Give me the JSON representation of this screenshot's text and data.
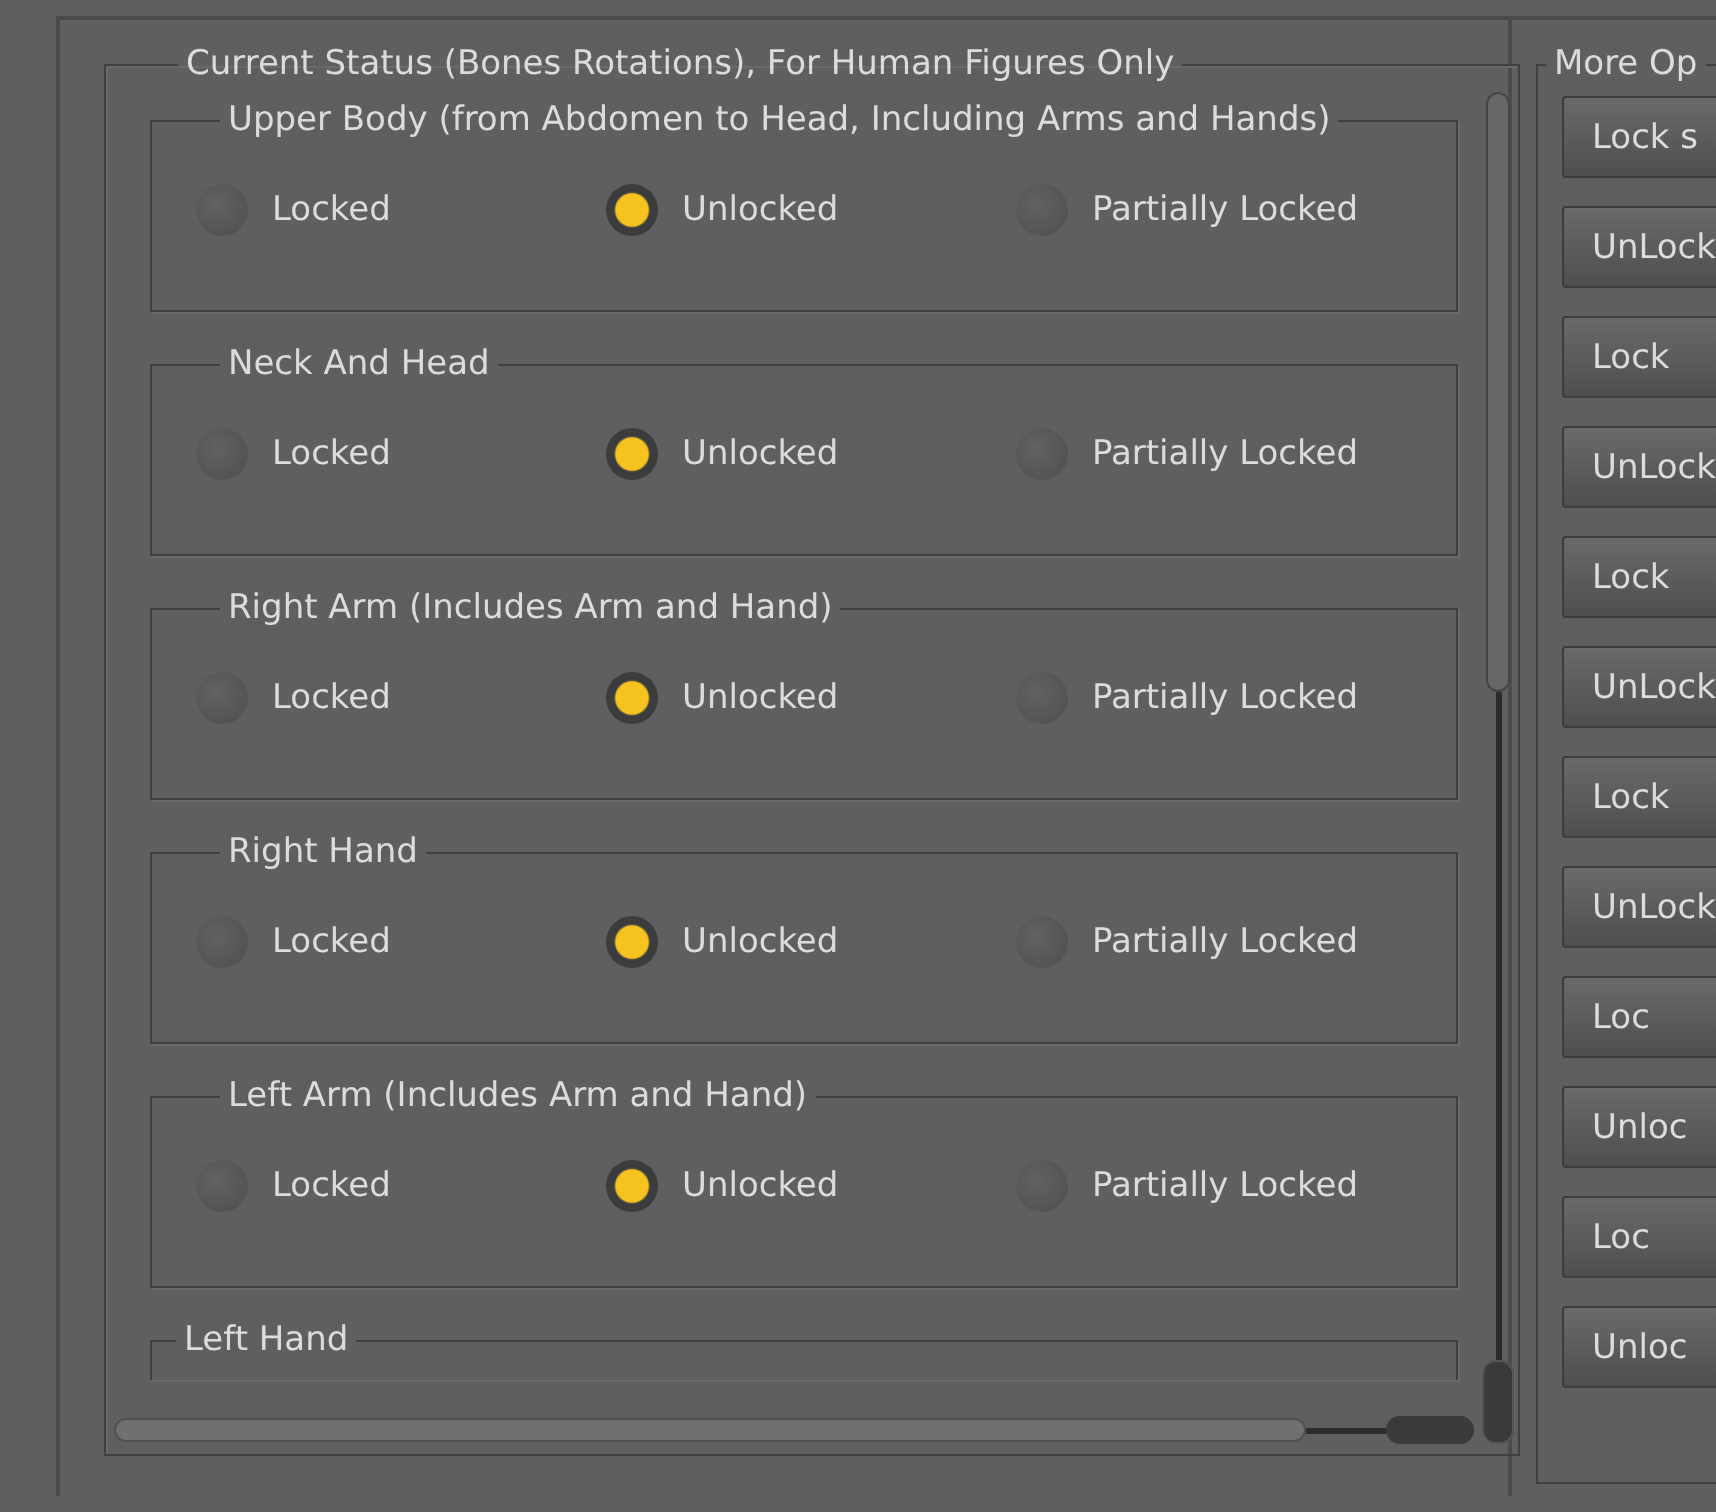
{
  "status_panel": {
    "title": "Current Status (Bones Rotations), For Human Figures Only",
    "groups": [
      {
        "title": "Upper Body (from Abdomen to Head, Including Arms and Hands)",
        "options": [
          {
            "label": "Locked",
            "selected": false
          },
          {
            "label": "Unlocked",
            "selected": true
          },
          {
            "label": "Partially Locked",
            "selected": false
          }
        ]
      },
      {
        "title": "Neck And Head",
        "options": [
          {
            "label": "Locked",
            "selected": false
          },
          {
            "label": "Unlocked",
            "selected": true
          },
          {
            "label": "Partially Locked",
            "selected": false
          }
        ]
      },
      {
        "title": "Right Arm (Includes Arm and Hand)",
        "options": [
          {
            "label": "Locked",
            "selected": false
          },
          {
            "label": "Unlocked",
            "selected": true
          },
          {
            "label": "Partially Locked",
            "selected": false
          }
        ]
      },
      {
        "title": "Right Hand",
        "options": [
          {
            "label": "Locked",
            "selected": false
          },
          {
            "label": "Unlocked",
            "selected": true
          },
          {
            "label": "Partially Locked",
            "selected": false
          }
        ]
      },
      {
        "title": "Left Arm (Includes Arm and Hand)",
        "options": [
          {
            "label": "Locked",
            "selected": false
          },
          {
            "label": "Unlocked",
            "selected": true
          },
          {
            "label": "Partially Locked",
            "selected": false
          }
        ]
      },
      {
        "title": "Left Hand"
      }
    ]
  },
  "more_options": {
    "title": "More Op",
    "buttons": [
      "Lock s",
      "UnLock",
      "Lock",
      "UnLock",
      "Lock",
      "UnLock",
      "Lock",
      "UnLock",
      "Loc",
      "Unloc",
      "Loc",
      "Unloc"
    ]
  }
}
